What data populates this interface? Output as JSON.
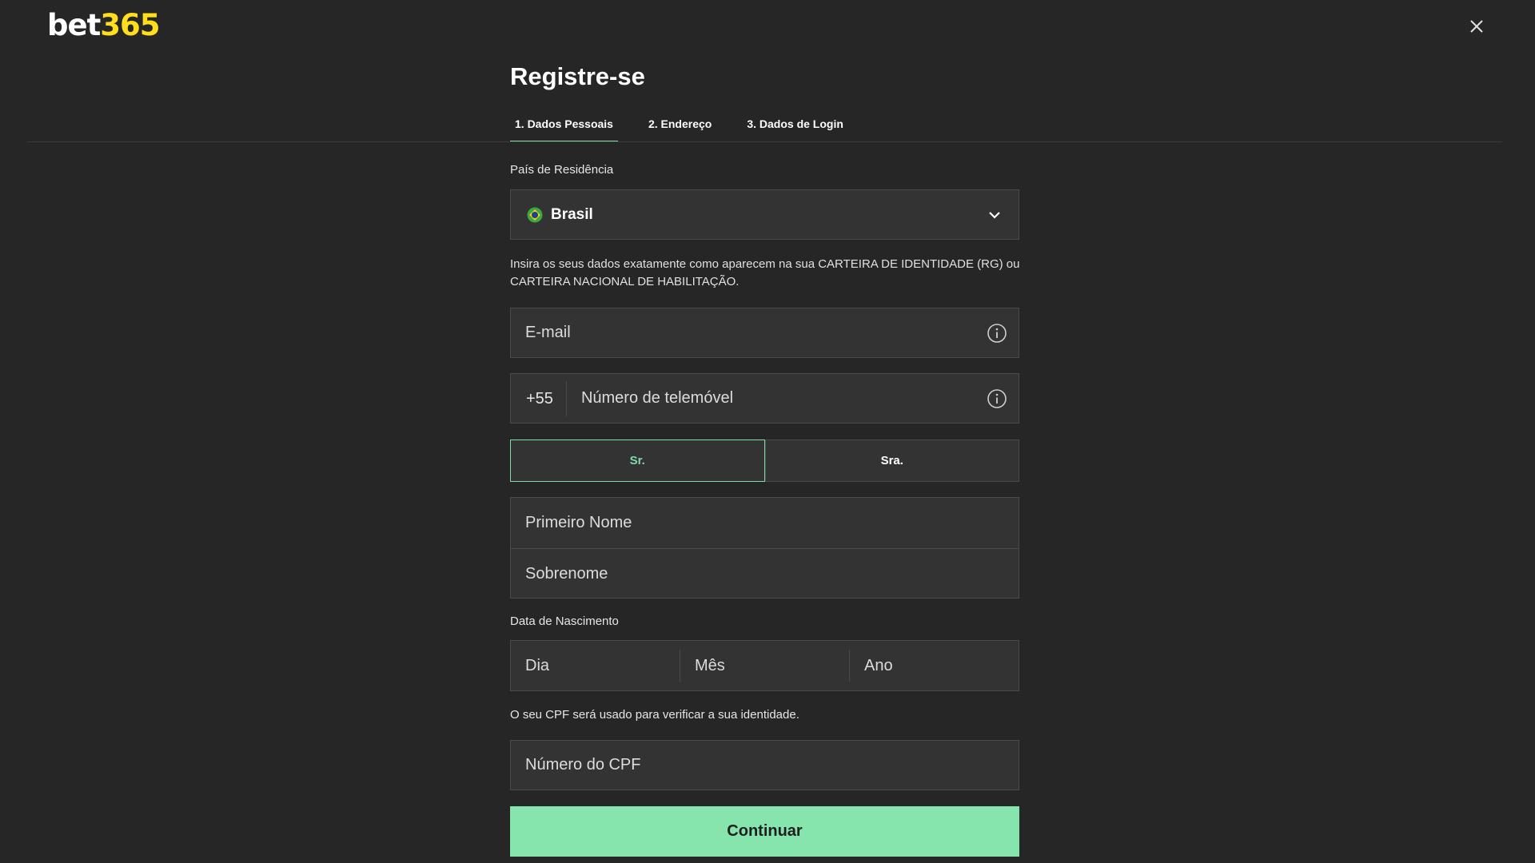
{
  "brand": {
    "logo_part1": "bet",
    "logo_part2": "365",
    "logo_white": "#ffffff",
    "logo_yellow": "#ffdf1b"
  },
  "header": {
    "title": "Registre-se",
    "close_icon": "close-icon"
  },
  "tabs": [
    {
      "label": "1.  Dados Pessoais",
      "active": true
    },
    {
      "label": "2.  Endereço",
      "active": false
    },
    {
      "label": "3.  Dados de Login",
      "active": false
    }
  ],
  "form": {
    "country_label": "País de Residência",
    "country_value": "Brasil",
    "country_flag_icon": "brazil-flag-icon",
    "id_info_text": "Insira os seus dados exatamente como aparecem na sua CARTEIRA DE IDENTIDADE (RG) ou CARTEIRA NACIONAL DE HABILITAÇÃO.",
    "email_placeholder": "E-mail",
    "phone_prefix": "+55",
    "phone_placeholder": "Número de telemóvel",
    "gender_options": [
      "Sr.",
      "Sra."
    ],
    "gender_selected": "Sr.",
    "first_name_placeholder": "Primeiro Nome",
    "last_name_placeholder": "Sobrenome",
    "dob_label": "Data de Nascimento",
    "dob_day_placeholder": "Dia",
    "dob_month_placeholder": "Mês",
    "dob_year_placeholder": "Ano",
    "cpf_info_text": "O seu CPF será usado para verificar a sua identidade.",
    "cpf_placeholder": "Número do CPF",
    "continue_label": "Continuar"
  },
  "colors": {
    "background": "#262626",
    "field_bg": "#333333",
    "accent": "#7ddca6",
    "button": "#86e4ad"
  }
}
